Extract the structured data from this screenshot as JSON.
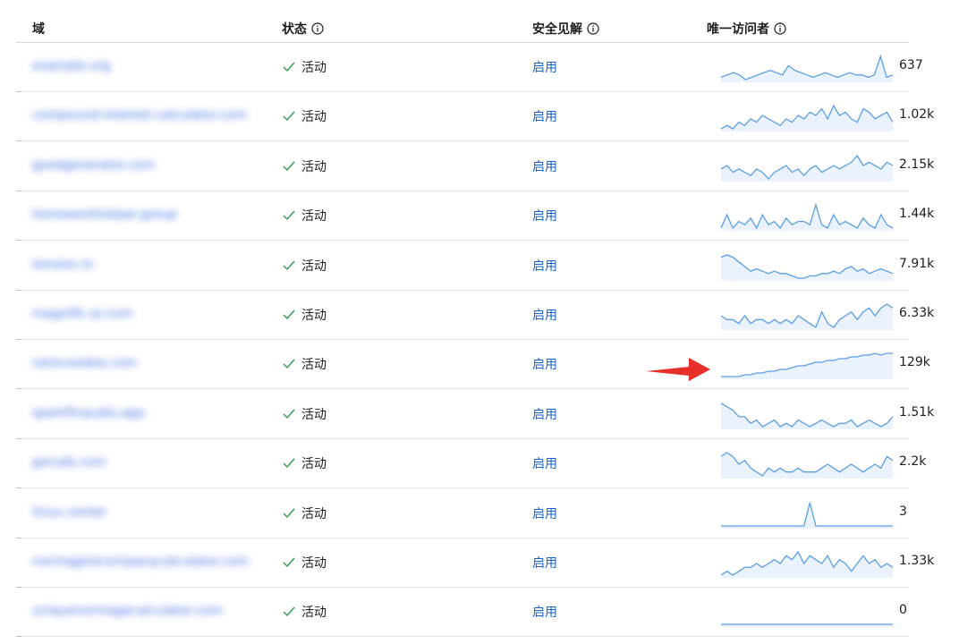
{
  "header": {
    "domain": "域",
    "status": "状态",
    "insights": "安全见解",
    "visitors": "唯一访问者"
  },
  "colors": {
    "link": "#1a63c8",
    "spark_line": "#5b9ee6",
    "spark_fill": "#eaf3fd",
    "check": "#2e9b4e",
    "arrow": "#e8302b"
  },
  "rows": [
    {
      "domain": "example.org",
      "status": "活动",
      "insights": "启用",
      "count": "637",
      "series": [
        4,
        5,
        6,
        5,
        3,
        4,
        5,
        6,
        7,
        6,
        5,
        9,
        7,
        6,
        5,
        4,
        5,
        6,
        5,
        4,
        5,
        6,
        5,
        5,
        4,
        5,
        13,
        4,
        5
      ]
    },
    {
      "domain": "compound-interest-calculator.com",
      "status": "活动",
      "insights": "启用",
      "count": "1.02k",
      "series": [
        3,
        4,
        3,
        5,
        4,
        6,
        5,
        7,
        6,
        5,
        4,
        6,
        5,
        7,
        6,
        8,
        7,
        9,
        6,
        10,
        7,
        8,
        6,
        5,
        9,
        8,
        6,
        7,
        8,
        5
      ]
    },
    {
      "domain": "goodgenerator.com",
      "status": "活动",
      "insights": "启用",
      "count": "2.15k",
      "series": [
        6,
        7,
        5,
        6,
        5,
        4,
        6,
        5,
        3,
        5,
        6,
        7,
        5,
        6,
        4,
        6,
        7,
        5,
        6,
        7,
        6,
        7,
        8,
        10,
        7,
        8,
        7,
        6,
        8,
        7
      ]
    },
    {
      "domain": "homeworkhelper.group",
      "status": "活动",
      "insights": "启用",
      "count": "1.44k",
      "series": [
        5,
        9,
        5,
        7,
        6,
        8,
        5,
        9,
        6,
        7,
        5,
        8,
        6,
        7,
        7,
        6,
        12,
        6,
        5,
        9,
        6,
        7,
        6,
        5,
        8,
        6,
        5,
        9,
        6,
        5
      ]
    },
    {
      "domain": "tension.io",
      "status": "活动",
      "insights": "启用",
      "count": "7.91k",
      "series": [
        12,
        13,
        12,
        10,
        8,
        6,
        7,
        6,
        5,
        6,
        5,
        5,
        4,
        3,
        3,
        4,
        4,
        5,
        5,
        6,
        5,
        7,
        8,
        6,
        7,
        5,
        6,
        7,
        6,
        5
      ]
    },
    {
      "domain": "magnific-ai.com",
      "status": "活动",
      "insights": "启用",
      "count": "6.33k",
      "series": [
        8,
        7,
        7,
        6,
        8,
        6,
        7,
        7,
        6,
        7,
        6,
        7,
        6,
        8,
        7,
        6,
        5,
        9,
        6,
        5,
        7,
        8,
        9,
        7,
        9,
        10,
        8,
        10,
        11,
        10
      ]
    },
    {
      "domain": "nerevoodoo.com",
      "status": "活动",
      "insights": "启用",
      "count": "129k",
      "series": [
        2,
        2,
        2,
        2,
        3,
        3,
        4,
        4,
        5,
        5,
        6,
        6,
        7,
        8,
        8,
        9,
        10,
        10,
        11,
        11,
        12,
        12,
        13,
        13,
        14,
        14,
        15,
        14,
        15,
        15
      ]
    },
    {
      "domain": "sparkfinaudio.app",
      "status": "活动",
      "insights": "启用",
      "count": "1.51k",
      "series": [
        12,
        11,
        10,
        8,
        8,
        6,
        7,
        5,
        6,
        7,
        5,
        6,
        5,
        7,
        6,
        5,
        6,
        7,
        6,
        5,
        6,
        6,
        7,
        5,
        6,
        7,
        6,
        5,
        6,
        8
      ]
    },
    {
      "domain": "goruds.com",
      "status": "活动",
      "insights": "启用",
      "count": "2.2k",
      "series": [
        10,
        11,
        10,
        8,
        9,
        7,
        6,
        5,
        7,
        6,
        7,
        6,
        6,
        7,
        6,
        6,
        6,
        7,
        8,
        7,
        6,
        7,
        8,
        7,
        6,
        7,
        8,
        7,
        10,
        9
      ]
    },
    {
      "domain": "linux.center",
      "status": "活动",
      "insights": "启用",
      "count": "3",
      "series": [
        1,
        1,
        1,
        1,
        1,
        1,
        1,
        1,
        1,
        1,
        1,
        1,
        1,
        1,
        1,
        14,
        1,
        1,
        1,
        1,
        1,
        1,
        1,
        1,
        1,
        1,
        1,
        1,
        1,
        1
      ]
    },
    {
      "domain": "normagestcompanycalculator.com",
      "status": "活动",
      "insights": "启用",
      "count": "1.33k",
      "series": [
        4,
        5,
        4,
        5,
        6,
        6,
        7,
        6,
        7,
        8,
        7,
        9,
        8,
        10,
        7,
        9,
        8,
        7,
        9,
        6,
        8,
        7,
        5,
        7,
        9,
        7,
        8,
        6,
        7,
        6
      ]
    },
    {
      "domain": "uniquenormagecalculator.com",
      "status": "活动",
      "insights": "启用",
      "count": "0",
      "series": [
        1,
        1,
        1,
        1,
        1,
        1,
        1,
        1,
        1,
        1,
        1,
        1,
        1,
        1,
        1,
        1,
        1,
        1,
        1,
        1,
        1,
        1,
        1,
        1,
        1,
        1,
        1,
        1,
        1,
        1
      ]
    }
  ]
}
